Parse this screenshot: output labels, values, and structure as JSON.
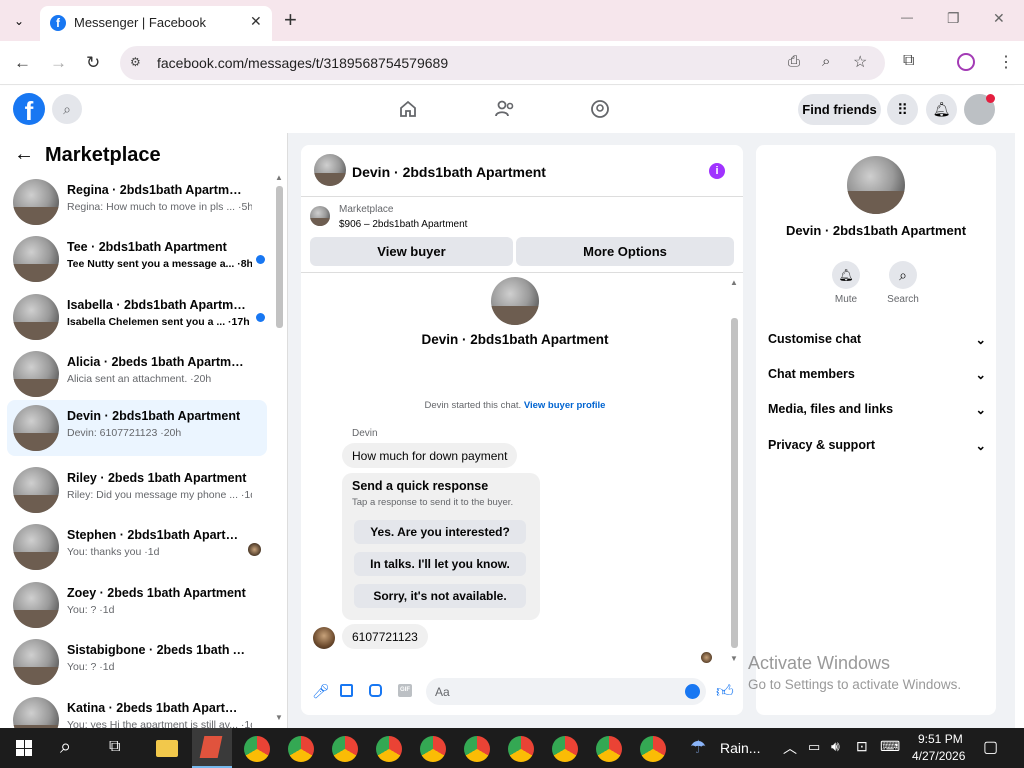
{
  "browser": {
    "tab_title": "Messenger | Facebook",
    "url": "facebook.com/messages/t/3189568754579689",
    "new_tab": "+",
    "minimize": "—",
    "restore": "❐",
    "close": "✕"
  },
  "header": {
    "find_friends": "Find friends"
  },
  "sidebar": {
    "title": "Marketplace",
    "items": [
      {
        "title": "Regina · 2bds1bath Apartment",
        "sub": "Regina: How much to move in pls ... ·5h",
        "unread": false
      },
      {
        "title": "Tee · 2bds1bath Apartment",
        "sub": "Tee Nutty sent you a message a... ·8h",
        "unread": true
      },
      {
        "title": "Isabella · 2bds1bath Apartment",
        "sub": "Isabella Chelemen sent you a ... ·17h",
        "unread": true
      },
      {
        "title": "Alicia · 2beds 1bath Apartment",
        "sub": "Alicia sent an attachment. ·20h",
        "unread": false
      },
      {
        "title": "Devin · 2bds1bath Apartment",
        "sub": "Devin: 6107721123 ·20h",
        "unread": false
      },
      {
        "title": "Riley · 2beds 1bath Apartment",
        "sub": "Riley: Did you message my phone ... ·1d",
        "unread": false
      },
      {
        "title": "Stephen · 2bds1bath Apartme...",
        "sub": "You: thanks you ·1d",
        "unread": false
      },
      {
        "title": "Zoey · 2beds 1bath Apartment",
        "sub": "You: ? ·1d",
        "unread": false
      },
      {
        "title": "Sistabigbone · 2beds 1bath Apa...",
        "sub": "You: ? ·1d",
        "unread": false
      },
      {
        "title": "Katina · 2beds 1bath Apartment",
        "sub": "You: yes Hi the apartment is still av... ·1d",
        "unread": false
      }
    ]
  },
  "chat": {
    "title": "Devin · 2bds1bath Apartment",
    "marketplace_label": "Marketplace",
    "listing": "$906 – 2bds1bath Apartment",
    "view_buyer": "View buyer",
    "more_options": "More Options",
    "profile_name": "Devin · 2bds1bath Apartment",
    "started_text": "Devin started this chat.",
    "view_buyer_profile": "View buyer profile",
    "sender_name": "Devin",
    "msg1": "How much for down payment",
    "quick_title": "Send a quick response",
    "quick_sub": "Tap a response to send it to the buyer.",
    "quick_replies": [
      "Yes. Are you interested?",
      "In talks. I'll let you know.",
      "Sorry, it's not available."
    ],
    "msg2": "6107721123",
    "composer_placeholder": "Aa"
  },
  "info": {
    "name": "Devin · 2bds1bath Apartment",
    "mute": "Mute",
    "search": "Search",
    "sections": [
      "Customise chat",
      "Chat members",
      "Media, files and links",
      "Privacy & support"
    ]
  },
  "watermark": {
    "line1": "Activate Windows",
    "line2": "Go to Settings to activate Windows."
  },
  "taskbar": {
    "weather": "Rain...",
    "time": "9:51 PM",
    "date": "4/27/2026"
  },
  "colors": {
    "accent": "#1877f2",
    "purple": "#a033ff",
    "tabstrip": "#f6e6ec"
  }
}
